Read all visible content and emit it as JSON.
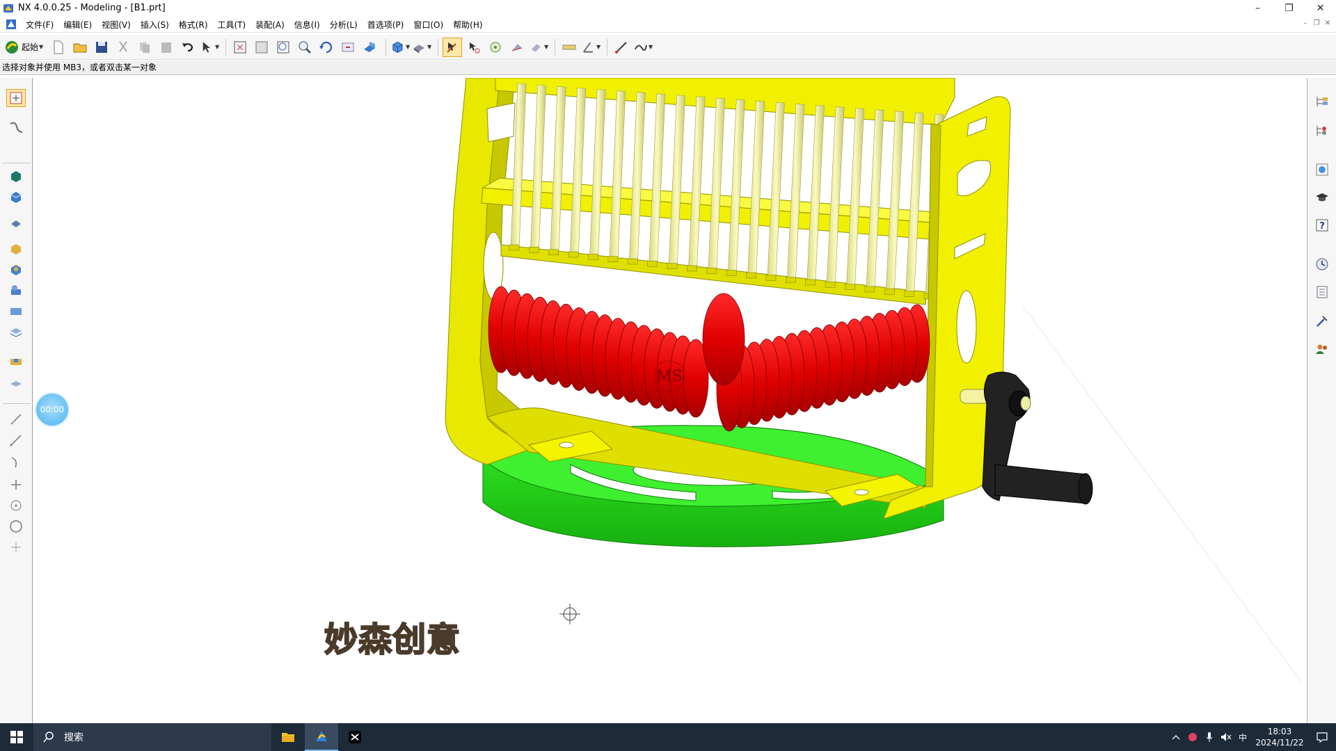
{
  "window": {
    "title": "NX 4.0.0.25 - Modeling - [B1.prt]",
    "controls": {
      "minimize": "–",
      "restore": "❐",
      "close": "✕"
    }
  },
  "menubar": {
    "items": [
      "文件(F)",
      "编辑(E)",
      "视图(V)",
      "插入(S)",
      "格式(R)",
      "工具(T)",
      "装配(A)",
      "信息(I)",
      "分析(L)",
      "首选项(P)",
      "窗口(O)",
      "帮助(H)"
    ]
  },
  "toolbar": {
    "start_label": "起始"
  },
  "statusline": {
    "prompt": "选择对象并使用 MB3，或者双击某一对象"
  },
  "timer": {
    "value": "00:00"
  },
  "watermark": {
    "text": "妙森创意"
  },
  "model": {
    "logo_text": "MS",
    "colors": {
      "frame": "#f0f000",
      "frame_shade": "#c8c800",
      "rods": "#f0f0a0",
      "roller": "#ee0000",
      "roller_shade": "#b00000",
      "base": "#22dd11",
      "base_shade": "#14a80a",
      "crank": "#1a1a1a"
    }
  },
  "taskbar": {
    "search_placeholder": "搜索",
    "ime": "中",
    "time": "18:03",
    "date": "2024/11/22"
  }
}
